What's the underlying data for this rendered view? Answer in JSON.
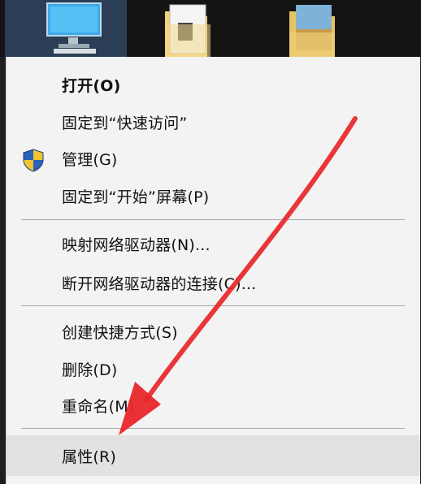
{
  "context_menu": {
    "items": [
      {
        "label": "打开(O)",
        "bold": true
      },
      {
        "label": "固定到“快速访问”"
      },
      {
        "label": "管理(G)",
        "icon": "uac-shield-icon"
      },
      {
        "label": "固定到“开始”屏幕(P)"
      },
      {
        "label": "映射网络驱动器(N)..."
      },
      {
        "label": "断开网络驱动器的连接(C)..."
      },
      {
        "label": "创建快捷方式(S)"
      },
      {
        "label": "删除(D)"
      },
      {
        "label": "重命名(M)"
      },
      {
        "label": "属性(R)",
        "highlighted": true
      }
    ]
  },
  "desktop": {
    "icons": [
      "this-pc-icon",
      "folder-document-icon",
      "folder-image-icon"
    ]
  },
  "colors": {
    "menu_bg": "#f3f3f3",
    "highlight_bg": "#e2e2e2",
    "annotation_arrow": "#e8262b"
  }
}
